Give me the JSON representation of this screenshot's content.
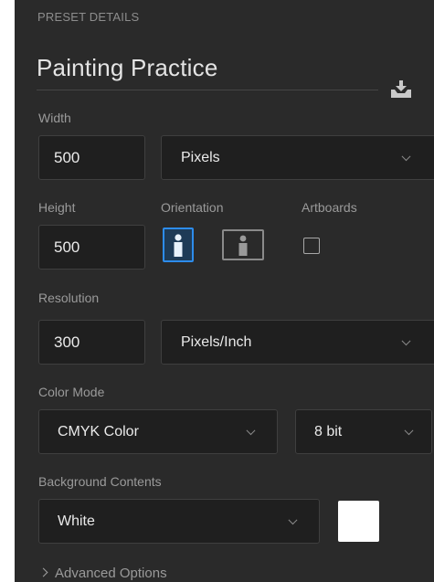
{
  "header": {
    "section_label": "PRESET DETAILS",
    "preset_name": "Painting Practice",
    "save_icon": "save-preset-icon"
  },
  "width": {
    "label": "Width",
    "value": "500",
    "unit": "Pixels"
  },
  "height": {
    "label": "Height",
    "value": "500"
  },
  "orientation": {
    "label": "Orientation",
    "selected": "portrait",
    "portrait_icon": "portrait-orientation-icon",
    "landscape_icon": "landscape-orientation-icon"
  },
  "artboards": {
    "label": "Artboards",
    "checked": false
  },
  "resolution": {
    "label": "Resolution",
    "value": "300",
    "unit": "Pixels/Inch"
  },
  "color_mode": {
    "label": "Color Mode",
    "mode": "CMYK Color",
    "depth": "8 bit"
  },
  "background": {
    "label": "Background Contents",
    "value": "White",
    "swatch_color": "#ffffff"
  },
  "advanced": {
    "label": "Advanced Options"
  },
  "colors": {
    "panel": "#2a2a2a",
    "field": "#1f1f1f",
    "accent": "#2d8ceb"
  }
}
